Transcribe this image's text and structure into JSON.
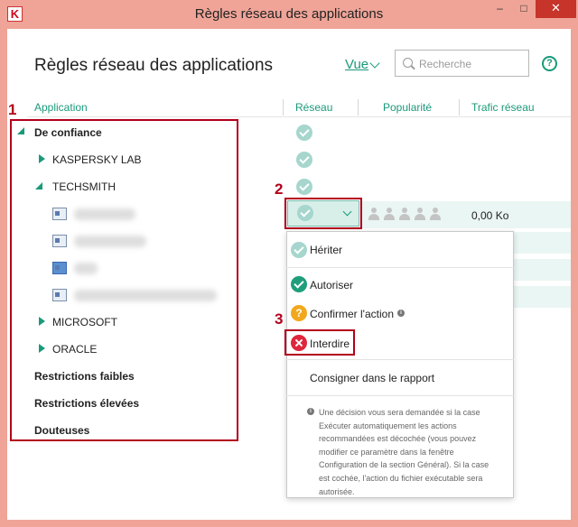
{
  "window": {
    "title": "Règles réseau des applications",
    "min": "–",
    "max": "□",
    "close": "✕",
    "logo": "K"
  },
  "header": {
    "title": "Règles réseau des applications",
    "view_label": "Vue",
    "search_placeholder": "Recherche",
    "help": "?"
  },
  "columns": {
    "application": "Application",
    "network": "Réseau",
    "popularity": "Popularité",
    "traffic": "Trafic réseau"
  },
  "tree": {
    "trusted": "De confiance",
    "kaspersky": "KASPERSKY LAB",
    "techsmith": "TECHSMITH",
    "microsoft": "MICROSOFT",
    "oracle": "ORACLE",
    "low": "Restrictions faibles",
    "high": "Restrictions élevées",
    "doubtful": "Douteuses"
  },
  "selected_row": {
    "traffic": "0,00 Ko",
    "popularity_stars": 0
  },
  "menu": {
    "inherit": "Hériter",
    "allow": "Autoriser",
    "confirm": "Confirmer l'action",
    "deny": "Interdire",
    "log": "Consigner dans le rapport",
    "note": "Une décision vous sera demandée si la case Exécuter automatiquement les actions recommandées est décochée (vous pouvez modifier ce paramètre dans la fenêtre Configuration de la section Général). Si la case est cochée, l'action du fichier exécutable sera autorisée."
  },
  "annotations": {
    "one": "1",
    "two": "2",
    "three": "3"
  },
  "colors": {
    "accent": "#1a9a7a",
    "annotation": "#b3001b",
    "deny": "#e0263a",
    "warn": "#f2a81d"
  }
}
